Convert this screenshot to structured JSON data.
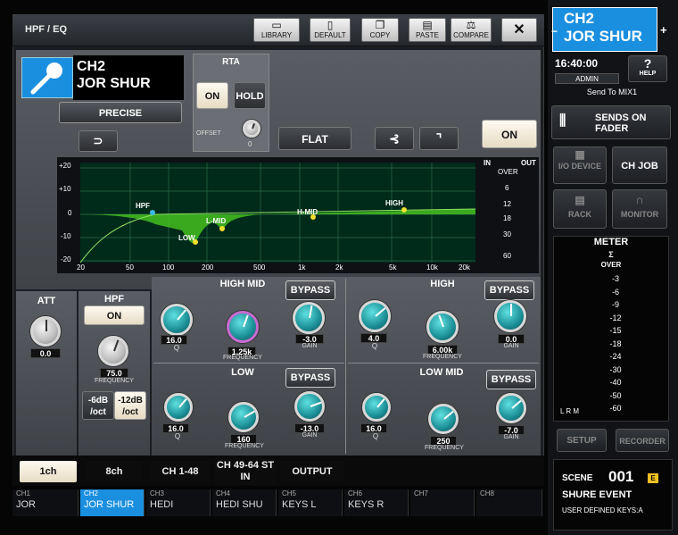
{
  "window": {
    "title": "HPF / EQ"
  },
  "toolbar": [
    {
      "label": "LIBRARY",
      "icon": "folder-icon"
    },
    {
      "label": "DEFAULT",
      "icon": "document-icon"
    },
    {
      "label": "COPY",
      "icon": "copy-icon"
    },
    {
      "label": "PASTE",
      "icon": "paste-icon"
    },
    {
      "label": "COMPARE",
      "icon": "compare-icon"
    }
  ],
  "channel": {
    "number": "CH2",
    "name": "JOR SHUR",
    "color": "#1a8fe0"
  },
  "eq_mode": "PRECISE",
  "rta": {
    "title": "RTA",
    "on_label": "ON",
    "hold_label": "HOLD",
    "offset_label": "OFFSET",
    "offset_value": "0"
  },
  "flat_label": "FLAT",
  "eq_on_label": "ON",
  "graph": {
    "db_labels": [
      "+20",
      "+10",
      "0",
      "-10",
      "-20"
    ],
    "freq_labels": [
      "20",
      "50",
      "100",
      "200",
      "500",
      "1k",
      "2k",
      "5k",
      "10k",
      "20k"
    ],
    "points": [
      {
        "label": "HPF",
        "color": "#3ab8e8"
      },
      {
        "label": "LOW",
        "color": "#f0e030"
      },
      {
        "label": "L-MID",
        "color": "#f0e030"
      },
      {
        "label": "H-MID",
        "color": "#f0e030"
      },
      {
        "label": "HIGH",
        "color": "#f0e030"
      }
    ]
  },
  "meter_in_out": {
    "in_label": "IN",
    "out_label": "OUT",
    "scale": [
      "OVER",
      "6",
      "12",
      "18",
      "30",
      "60"
    ]
  },
  "att": {
    "label": "ATT",
    "value": "0.0"
  },
  "hpf": {
    "label": "HPF",
    "on_label": "ON",
    "value": "75.0",
    "param": "FREQUENCY",
    "slope_a": "-6dB /oct",
    "slope_b": "-12dB /oct"
  },
  "bands": {
    "high_mid": {
      "title": "HIGH MID",
      "bypass": "BYPASS",
      "q": "16.0",
      "freq": "1.25k",
      "gain": "-3.0"
    },
    "high": {
      "title": "HIGH",
      "bypass": "BYPASS",
      "q": "4.0",
      "freq": "6.00k",
      "gain": "0.0"
    },
    "low": {
      "title": "LOW",
      "bypass": "BYPASS",
      "q": "16.0",
      "freq": "160",
      "gain": "-13.0"
    },
    "low_mid": {
      "title": "LOW MID",
      "bypass": "BYPASS",
      "q": "16.0",
      "freq": "250",
      "gain": "-7.0"
    },
    "q_label": "Q",
    "freq_label": "FREQUENCY",
    "gain_label": "GAIN"
  },
  "tabs": [
    "1ch",
    "8ch",
    "CH 1-48",
    "CH 49-64 ST IN",
    "OUTPUT"
  ],
  "channel_strip": [
    {
      "num": "CH1",
      "name": "JOR"
    },
    {
      "num": "CH2",
      "name": "JOR SHUR"
    },
    {
      "num": "CH3",
      "name": "HEDI"
    },
    {
      "num": "CH4",
      "name": "HEDI SHU"
    },
    {
      "num": "CH5",
      "name": "KEYS L"
    },
    {
      "num": "CH6",
      "name": "KEYS R"
    },
    {
      "num": "CH7",
      "name": ""
    },
    {
      "num": "CH8",
      "name": ""
    }
  ],
  "right_panel": {
    "channel_num": "CH2",
    "channel_name": "JOR SHUR",
    "time": "16:40:00",
    "user": "ADMIN",
    "help": "HELP",
    "send_to": "Send To MIX1",
    "sends_on_fader": "SENDS ON FADER",
    "io_device": "I/O DEVICE",
    "ch_job": "CH JOB",
    "rack": "RACK",
    "monitor": "MONITOR",
    "meter_title": "METER",
    "meter_sigma": "Σ",
    "meter_over": "OVER",
    "meter_scale": [
      "-3",
      "-6",
      "-9",
      "-12",
      "-15",
      "-18",
      "-24",
      "-30",
      "-40",
      "-50",
      "-60"
    ],
    "meter_lrm": "L  R  M",
    "setup": "SETUP",
    "recorder": "RECORDER",
    "scene_label": "SCENE",
    "scene_num": "001",
    "scene_flag": "E",
    "scene_name": "SHURE EVENT",
    "user_keys": "USER DEFINED KEYS:A"
  }
}
